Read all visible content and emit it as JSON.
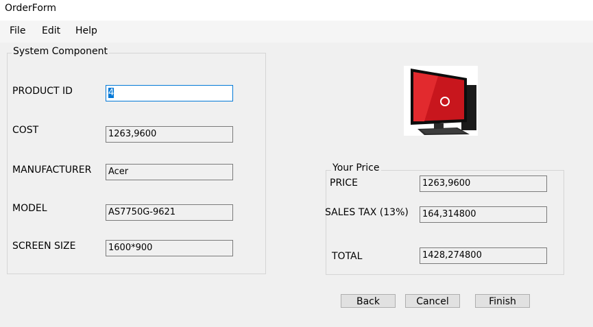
{
  "window": {
    "title": "OrderForm"
  },
  "menu": {
    "items": [
      "File",
      "Edit",
      "Help"
    ]
  },
  "system_component": {
    "title": "System Component",
    "product_id": {
      "label": "PRODUCT ID",
      "value": "4"
    },
    "cost": {
      "label": "COST",
      "value": "1263,9600"
    },
    "manufacturer": {
      "label": "MANUFACTURER",
      "value": "Acer"
    },
    "model": {
      "label": "MODEL",
      "value": "AS7750G-9621"
    },
    "screen_size": {
      "label": "SCREEN SIZE",
      "value": "1600*900"
    }
  },
  "product_image": {
    "icon": "desktop-computer-image"
  },
  "your_price": {
    "title": "Your Price",
    "price": {
      "label": "PRICE",
      "value": "1263,9600"
    },
    "sales_tax": {
      "label": "SALES TAX (13%)",
      "value": "164,314800"
    },
    "total": {
      "label": "TOTAL",
      "value": "1428,274800"
    }
  },
  "buttons": {
    "back": "Back",
    "cancel": "Cancel",
    "finish": "Finish"
  },
  "colors": {
    "focus_border": "#0078d7",
    "window_bg": "#f0f0f0"
  }
}
